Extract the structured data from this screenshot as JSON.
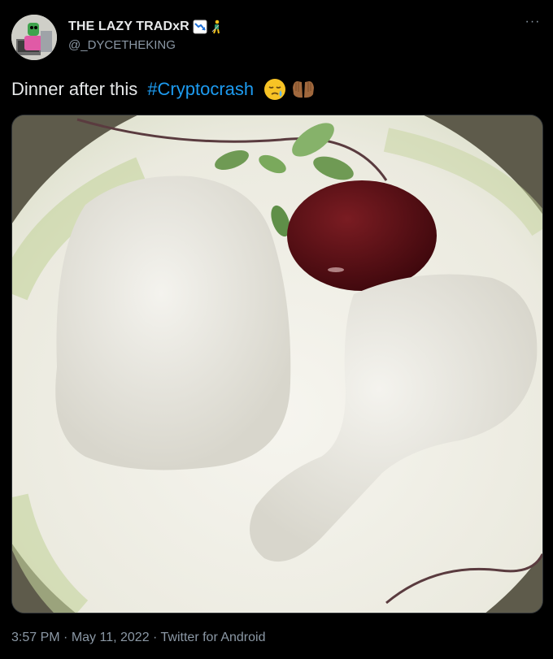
{
  "author": {
    "display_name": "THE LAZY TRADxR",
    "handle": "@_DYCETHEKING",
    "badges": [
      "chart-decreasing-emoji",
      "person-golfing-emoji"
    ],
    "avatar": "avatar-illustration"
  },
  "more_icon": "more-options-icon",
  "tweet": {
    "text": "Dinner after this",
    "hashtag": "#Cryptocrash",
    "emojis": [
      "sad-relieved-face-emoji",
      "palms-up-together-emoji"
    ]
  },
  "media": {
    "description_icon": "photo",
    "colors": {
      "plate": "#f2f1ea",
      "rim_green": "#c9d7a8",
      "sauce": "#5a0f15",
      "rice": "#ecebe4"
    }
  },
  "timestamp": {
    "time": "3:57 PM",
    "separator": "·",
    "date": "May 11, 2022",
    "source": "Twitter for Android"
  },
  "colors": {
    "background": "#000000",
    "text": "#e7e9ea",
    "muted": "#8b98a5",
    "link": "#1d9bf0"
  }
}
